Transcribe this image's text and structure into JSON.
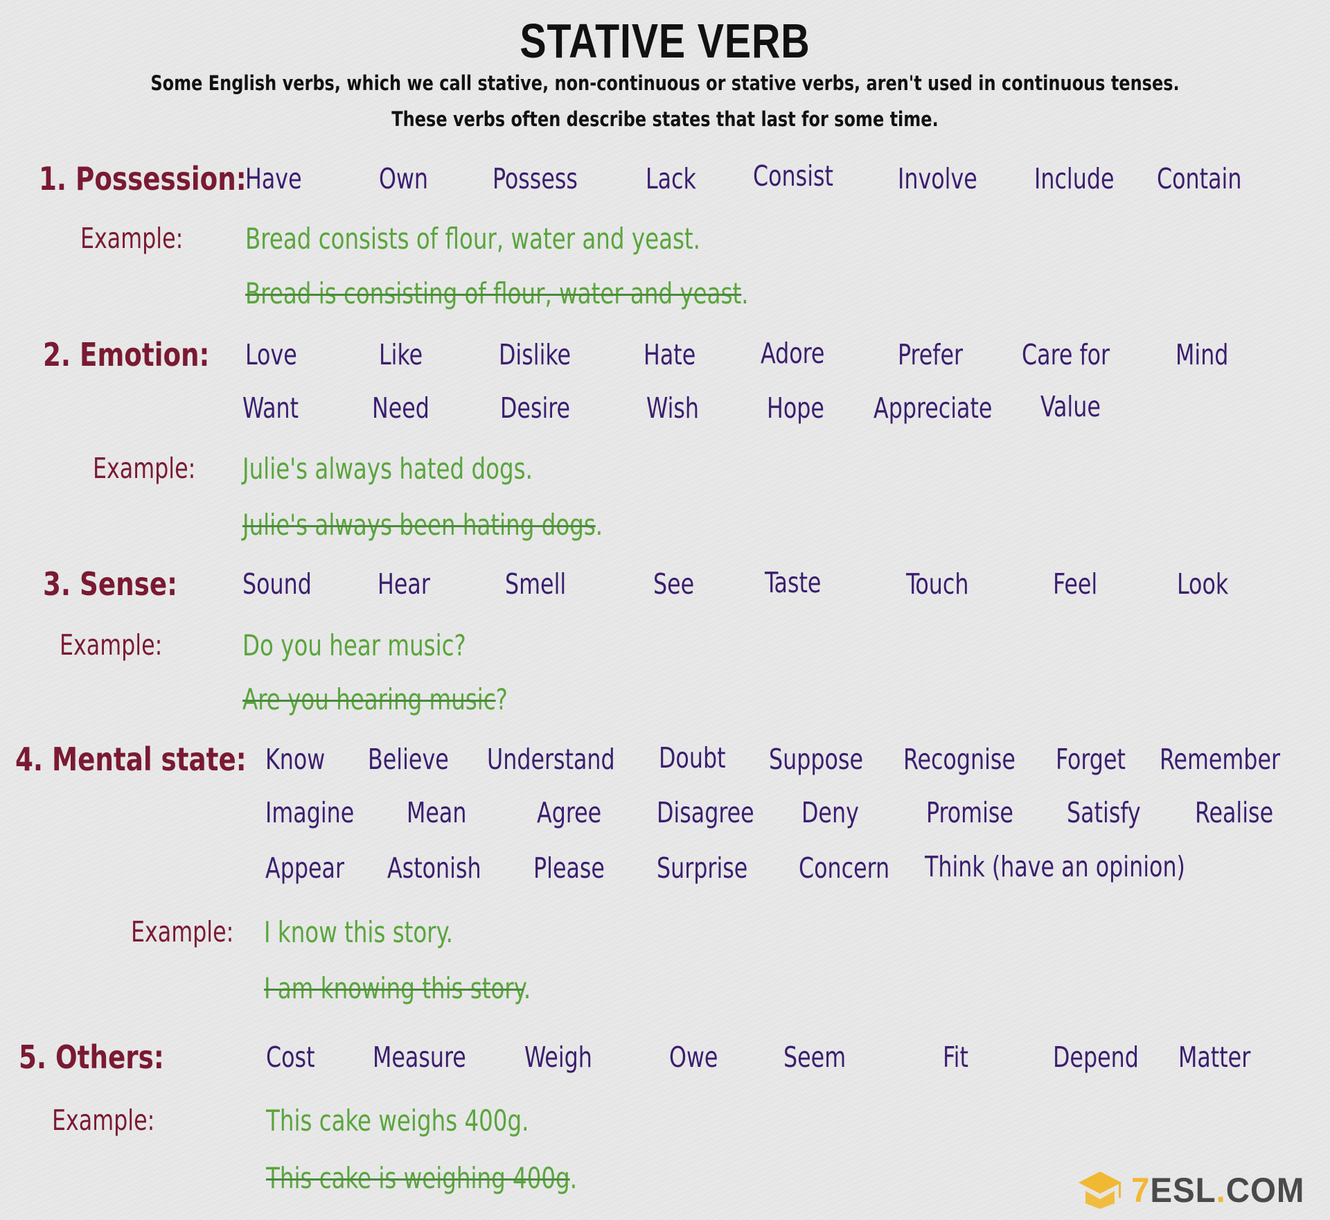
{
  "title": "STATIVE VERB",
  "subtitle": [
    "Some English verbs, which we call stative, non-continuous or stative verbs, aren't used in continuous tenses.",
    "These verbs often describe states that last for some time."
  ],
  "example_label": "Example:",
  "colors": {
    "heading": "#7a1a32",
    "verb": "#3b1e6e",
    "example": "#5aa53c",
    "logo_accent": "#f0b833",
    "logo_text": "#4a4a4a"
  },
  "sections": [
    {
      "heading": "1. Possession:",
      "rows": [
        [
          "Have",
          "Own",
          "Possess",
          "Lack",
          "Consist",
          "Involve",
          "Include",
          "Contain"
        ]
      ],
      "correct": "Bread consists of flour, water and yeast.",
      "wrong": "Bread is consisting of flour, water and yeast",
      "wrong_end": "."
    },
    {
      "heading": "2. Emotion:",
      "rows": [
        [
          "Love",
          "Like",
          "Dislike",
          "Hate",
          "Adore",
          "Prefer",
          "Care for",
          "Mind"
        ],
        [
          "Want",
          "Need",
          "Desire",
          "Wish",
          "Hope",
          "Appreciate",
          "Value"
        ]
      ],
      "correct": "Julie's always hated dogs.",
      "wrong": "Julie's always been hating dogs",
      "wrong_end": "."
    },
    {
      "heading": "3. Sense:",
      "rows": [
        [
          "Sound",
          "Hear",
          "Smell",
          "See",
          "Taste",
          "Touch",
          "Feel",
          "Look"
        ]
      ],
      "correct": "Do you hear music?",
      "wrong": "Are you hearing music",
      "wrong_end": "?"
    },
    {
      "heading": "4. Mental state:",
      "rows": [
        [
          "Know",
          "Believe",
          "Understand",
          "Doubt",
          "Suppose",
          "Recognise",
          "Forget",
          "Remember"
        ],
        [
          "Imagine",
          "Mean",
          "Agree",
          "Disagree",
          "Deny",
          "Promise",
          "Satisfy",
          "Realise"
        ],
        [
          "Appear",
          "Astonish",
          "Please",
          "Surprise",
          "Concern",
          "Think (have an opinion)"
        ]
      ],
      "correct": "I know this story.",
      "wrong": "I am knowing this story",
      "wrong_end": "."
    },
    {
      "heading": "5. Others:",
      "rows": [
        [
          "Cost",
          "Measure",
          "Weigh",
          "Owe",
          "Seem",
          "Fit",
          "Depend",
          "Matter"
        ]
      ],
      "correct": "This cake weighs 400g.",
      "wrong": "This cake is weighing 400g",
      "wrong_end": "."
    }
  ],
  "logo": {
    "icon": "graduation-cap-icon",
    "prefix": "7",
    "brand": "ESL",
    "dot": ".",
    "suffix": "COM"
  }
}
